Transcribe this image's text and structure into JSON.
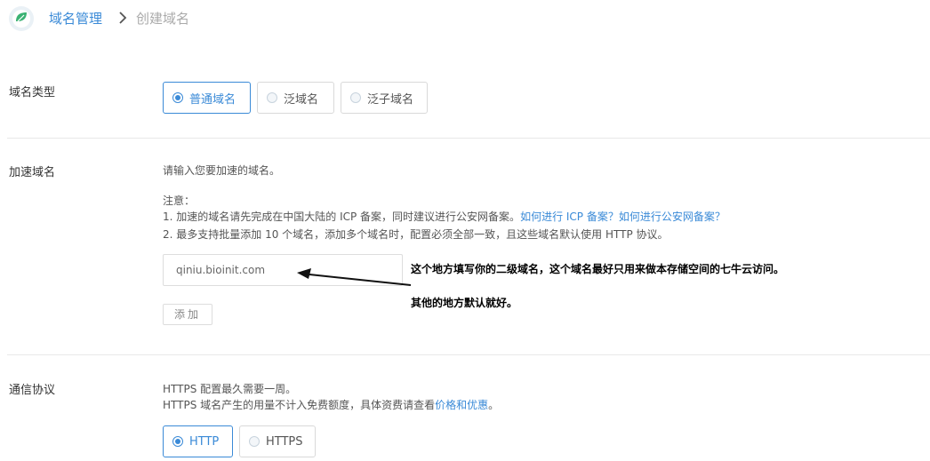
{
  "breadcrumb": {
    "parent": "域名管理",
    "current": "创建域名"
  },
  "domain_type": {
    "label": "域名类型",
    "options": [
      {
        "label": "普通域名",
        "selected": true
      },
      {
        "label": "泛域名",
        "selected": false
      },
      {
        "label": "泛子域名",
        "selected": false
      }
    ]
  },
  "accel_domain": {
    "label": "加速域名",
    "prompt": "请输入您要加速的域名。",
    "notice_title": "注意：",
    "notice_1_text": "1. 加速的域名请先完成在中国大陆的 ICP 备案，同时建议进行公安网备案。",
    "notice_1_link": "如何进行 ICP 备案？如何进行公安网备案？",
    "notice_2_text": "2. 最多支持批量添加 10 个域名，添加多个域名时，配置必须全部一致，且这些域名默认使用 HTTP 协议。",
    "input_value": "qiniu.bioinit.com",
    "add_label": "添加"
  },
  "annotation": {
    "line1": "这个地方填写你的二级域名，这个域名最好只用来做本存储空间的七牛云访问。",
    "line2": "其他的地方默认就好。"
  },
  "protocol": {
    "label": "通信协议",
    "desc_1": "HTTPS 配置最久需要一周。",
    "desc_2_text": "HTTPS 域名产生的用量不计入免费额度，具体资费请查看",
    "desc_2_link": "价格和优惠",
    "desc_2_end": "。",
    "options": [
      {
        "label": "HTTP",
        "selected": true
      },
      {
        "label": "HTTPS",
        "selected": false
      }
    ]
  },
  "colors": {
    "accent": "#3a8ad7",
    "logo_green": "#3bb273"
  }
}
